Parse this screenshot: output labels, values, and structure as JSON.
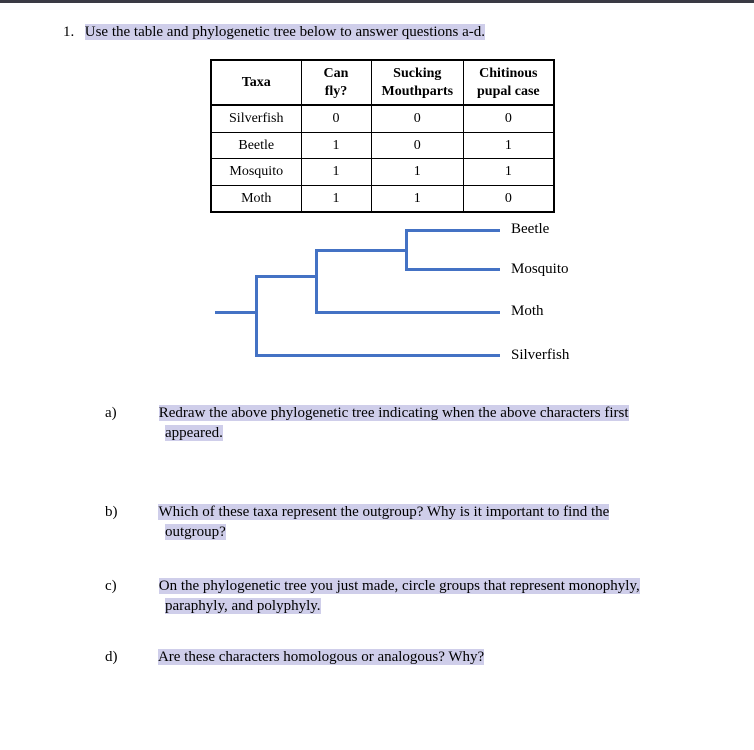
{
  "question": {
    "number": "1.",
    "intro": "Use the table and phylogenetic tree below to answer questions a-d."
  },
  "table": {
    "headers": {
      "taxa": "Taxa",
      "fly": "Can fly?",
      "mouth": "Sucking Mouthparts",
      "pupal": "Chitinous pupal case"
    },
    "rows": {
      "r0": {
        "taxa": "Silverfish",
        "fly": "0",
        "mouth": "0",
        "pupal": "0"
      },
      "r1": {
        "taxa": "Beetle",
        "fly": "1",
        "mouth": "0",
        "pupal": "1"
      },
      "r2": {
        "taxa": "Mosquito",
        "fly": "1",
        "mouth": "1",
        "pupal": "1"
      },
      "r3": {
        "taxa": "Moth",
        "fly": "1",
        "mouth": "1",
        "pupal": "0"
      }
    }
  },
  "tree": {
    "tips": {
      "beetle": "Beetle",
      "mosquito": "Mosquito",
      "moth": "Moth",
      "silverfish": "Silverfish"
    }
  },
  "subs": {
    "a": {
      "label": "a)",
      "text1": "Redraw the above phylogenetic tree indicating when the above characters first",
      "text2": "appeared."
    },
    "b": {
      "label": "b)",
      "text1": "Which of these taxa represent the outgroup? Why is it important to find the",
      "text2": "outgroup?"
    },
    "c": {
      "label": "c)",
      "text1": "On the phylogenetic tree you just made, circle groups that represent monophyly,",
      "text2": "paraphyly, and polyphyly."
    },
    "d": {
      "label": "d)",
      "text": "Are these characters homologous or analogous? Why?"
    }
  }
}
